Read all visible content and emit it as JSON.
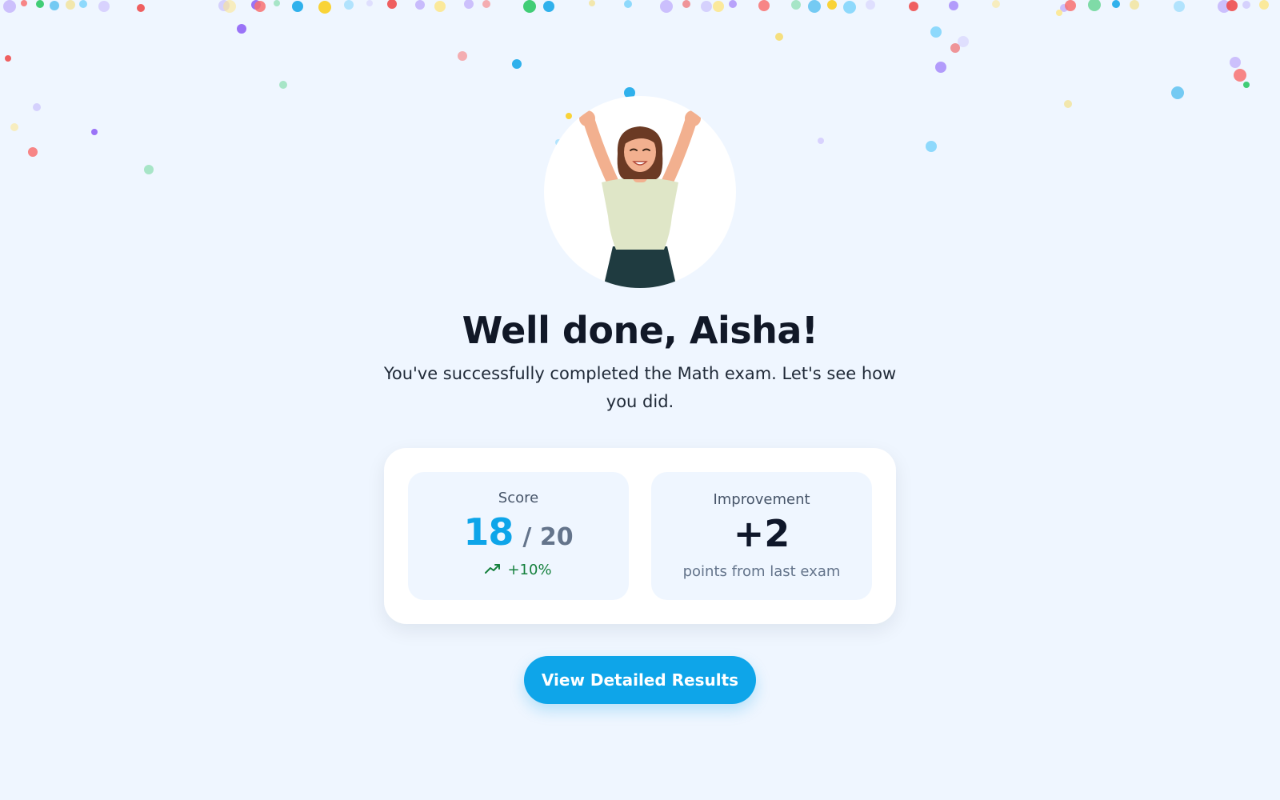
{
  "colors": {
    "background": "#eff6ff",
    "accent": "#0ea5e9",
    "positive": "#15803d",
    "confetti": [
      "#8b5cf6",
      "#f87171",
      "#22c55e",
      "#0ea5e9",
      "#facc15",
      "#7dd3fc",
      "#c4b5fd",
      "#ef4444",
      "#a78bfa",
      "#fde68a"
    ]
  },
  "hero": {
    "illustration": "celebrating-student-illustration",
    "title": "Well done, Aisha!",
    "subtitle": "You've successfully completed the Math exam. Let's see how you did."
  },
  "stats": {
    "score": {
      "label": "Score",
      "value": "18",
      "total": "/ 20",
      "trend_icon": "trending-up-icon",
      "trend": "+10%"
    },
    "improvement": {
      "label": "Improvement",
      "value": "+2",
      "note": "points from last exam"
    }
  },
  "cta": {
    "label": "View Detailed Results"
  }
}
